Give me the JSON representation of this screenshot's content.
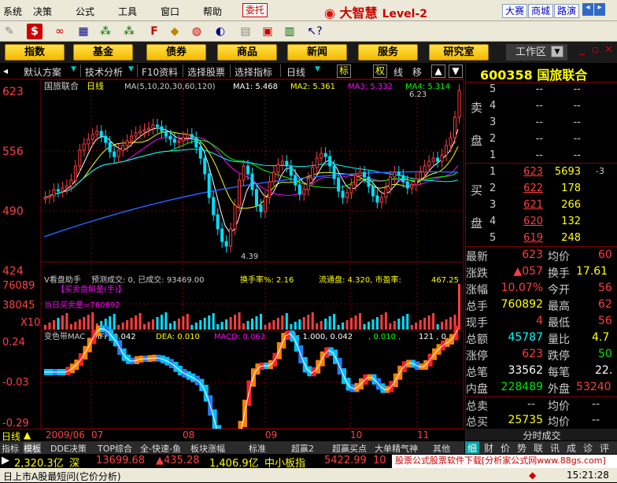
{
  "menu": {
    "items": [
      "系统",
      "决策",
      "公式",
      "工具",
      "窗口",
      "帮助"
    ],
    "weituo": "委托",
    "logo_text": "大智慧",
    "logo_level": "Level-2",
    "right_tabs": [
      "大赛",
      "商城",
      "路演"
    ]
  },
  "categories": [
    "指数",
    "基金",
    "债券",
    "商品",
    "新闻",
    "服务",
    "研究室"
  ],
  "workspace": "工作区",
  "chart_tabs": {
    "scheme": "默认方案",
    "tech": "技术分析",
    "f10": "F10资料",
    "pick_stock": "选择股票",
    "pick_indicator": "选择指标",
    "period": "日线",
    "biao": "标",
    "quan": "权",
    "line": "线",
    "move": "移"
  },
  "main_chart": {
    "stock": "国旅联合",
    "period": "日线",
    "ma_params": "MA(5,10,20,30,60,120)",
    "ma_values": [
      {
        "label": "MA1:",
        "value": "5.468",
        "color": "#ffffff"
      },
      {
        "label": "MA2:",
        "value": "5.361",
        "color": "#ffff00"
      },
      {
        "label": "MA3:",
        "value": "5.332",
        "color": "#ff00ff"
      },
      {
        "label": "MA4:",
        "value": "5.314",
        "color": "#00ff00"
      }
    ],
    "y_ticks": [
      "623",
      "556",
      "490",
      "424"
    ],
    "high_note": "6.23",
    "low_note": "4.39"
  },
  "volume_panel": {
    "title": "V看盘助手",
    "forecast": "预测成交: 0, 已成交: 93469.00",
    "turnover": "换手率%: 2.16",
    "float_cap": "流通盘: 4.320, 市盈率:",
    "pe": "467.25",
    "buy_sell_label": "【买卖盘解量(手)】",
    "today_net": "当日买卖量=760892",
    "y_ticks": [
      "76089",
      "38045"
    ],
    "scale": "X10"
  },
  "macd_panel": {
    "title": "变色带MAC",
    "diff": "DIFF: 0.042",
    "dea": "DEA: 0.010",
    "macd": "MACD: 0.063",
    "zhu": "主升: 1.000, 0.042",
    "extra": ", 0.010 ,",
    "tail": "121 , 0.",
    "y_ticks": [
      "0.24",
      "-0.03",
      "-0.29"
    ]
  },
  "date_axis": {
    "mode": "日线",
    "labels": [
      "2009/06",
      "07",
      "08",
      "09",
      "10",
      "11"
    ]
  },
  "quote": {
    "code": "600358",
    "name": "国旅联合",
    "sell_label_1": "卖",
    "sell_label_2": "盘",
    "buy_label_1": "买",
    "buy_label_2": "盘",
    "sell": [
      {
        "lvl": "5",
        "px": "--",
        "vol": "--"
      },
      {
        "lvl": "4",
        "px": "--",
        "vol": "--"
      },
      {
        "lvl": "3",
        "px": "--",
        "vol": "--"
      },
      {
        "lvl": "2",
        "px": "--",
        "vol": "--"
      },
      {
        "lvl": "1",
        "px": "--",
        "vol": "--"
      }
    ],
    "buy": [
      {
        "lvl": "1",
        "px": "623",
        "vol": "5693",
        "chg": "-3"
      },
      {
        "lvl": "2",
        "px": "622",
        "vol": "178",
        "chg": ""
      },
      {
        "lvl": "3",
        "px": "621",
        "vol": "266",
        "chg": ""
      },
      {
        "lvl": "4",
        "px": "620",
        "vol": "132",
        "chg": ""
      },
      {
        "lvl": "5",
        "px": "619",
        "vol": "248",
        "chg": ""
      }
    ],
    "stats": {
      "zuixin_l": "最新",
      "zuixin_v": "623",
      "junjia_l": "均价",
      "junjia_v": "60",
      "zhangdie_l": "涨跌",
      "zhangdie_v": "▲057",
      "huanshou_l": "换手",
      "huanshou_v": "17.61",
      "zhangfu_l": "涨幅",
      "zhangfu_v": "10.07%",
      "jinkai_l": "今开",
      "jinkai_v": "56",
      "zongshou_l": "总手",
      "zongshou_v": "760892",
      "zuigao_l": "最高",
      "zuigao_v": "62",
      "xianshou_l": "现手",
      "xianshou_v": "4",
      "zuidi_l": "最低",
      "zuidi_v": "56",
      "zonge_l": "总额",
      "zonge_v": "45787",
      "liangbi_l": "量比",
      "liangbi_v": "4.7",
      "zhangting_l": "涨停",
      "zhangting_v": "623",
      "dieting_l": "跌停",
      "dieting_v": "50",
      "zongbi_l": "总笔",
      "zongbi_v": "33562",
      "meibi_l": "每笔",
      "meibi_v": "22.",
      "neipan_l": "内盘",
      "neipan_v": "228489",
      "waipan_l": "外盘",
      "waipan_v": "53240",
      "zongmai_l": "总卖",
      "zongmai_v": "--",
      "junjia2_l": "均价",
      "junjia2_v": "--",
      "zongmai2_l": "总买",
      "zongmai2_v": "25735",
      "junjia3_l": "均价",
      "junjia3_v": "--"
    },
    "fenshi": "分时成交"
  },
  "bottom_tabs": [
    "指标",
    "模板",
    "DDE决策",
    "TOP综合",
    "全-快速-鱼",
    "板块涨幅",
    "标准",
    "超赢2",
    "超赢买点",
    "大单精气神",
    "其他"
  ],
  "right_tabs": [
    "细",
    "财",
    "价",
    "势",
    "联",
    "讯",
    "成",
    "诊",
    "评"
  ],
  "ticker": {
    "sh_val": "2,320.3亿",
    "sz_label": "深",
    "sz_idx": "13699.68",
    "sz_chg": "▲435.28",
    "sz_amt": "1,406.9亿",
    "zxb_label": "中小板指",
    "zxb_idx": "5422.99",
    "zxb_chg": "10"
  },
  "ad_text": "股票公式股票软件下载[分析家公式网www.88gs.com]",
  "status": {
    "left": "日上市A股最短问(它价分析)",
    "time": "15:21:28"
  }
}
